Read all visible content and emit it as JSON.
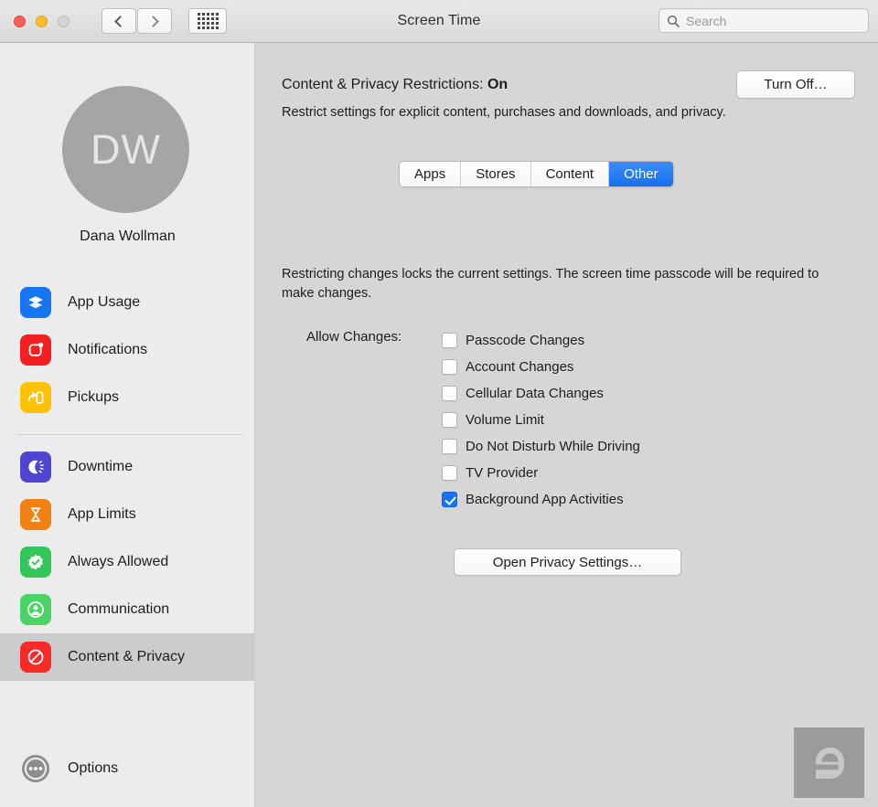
{
  "window": {
    "title": "Screen Time",
    "traffic_lights": [
      "close",
      "minimize",
      "zoom"
    ],
    "back_label": "Back",
    "forward_label": "Forward",
    "grid_label": "Show All"
  },
  "search": {
    "placeholder": "Search",
    "value": "",
    "icon": "search-icon"
  },
  "sidebar": {
    "avatar_initials": "DW",
    "user_name": "Dana Wollman",
    "groups": [
      {
        "items": [
          {
            "label": "App Usage",
            "icon": "layers-icon",
            "color": "#1675f2",
            "selected": false
          },
          {
            "label": "Notifications",
            "icon": "notification-icon",
            "color": "#f4201f",
            "selected": false
          },
          {
            "label": "Pickups",
            "icon": "pickup-arrow-icon",
            "color": "#ffc200",
            "selected": false
          }
        ]
      },
      {
        "items": [
          {
            "label": "Downtime",
            "icon": "moon-sun-icon",
            "color": "#4f46cf",
            "selected": false
          },
          {
            "label": "App Limits",
            "icon": "hourglass-icon",
            "color": "#f08215",
            "selected": false
          },
          {
            "label": "Always Allowed",
            "icon": "checkbadge-icon",
            "color": "#33c759",
            "selected": false
          },
          {
            "label": "Communication",
            "icon": "person-icon",
            "color": "#4cd365",
            "selected": false
          },
          {
            "label": "Content & Privacy",
            "icon": "prohibit-icon",
            "color": "#fa2a27",
            "selected": true
          }
        ]
      },
      {
        "items": [
          {
            "label": "Options",
            "icon": "ellipsis-icon",
            "color": "#8c8c8c",
            "selected": false
          }
        ]
      }
    ]
  },
  "main": {
    "header_title_prefix": "Content & Privacy Restrictions: ",
    "header_title_state": "On",
    "header_subtitle": "Restrict settings for explicit content, purchases and downloads, and privacy.",
    "turn_off_button": "Turn Off…",
    "tabs": [
      {
        "label": "Apps",
        "active": false
      },
      {
        "label": "Stores",
        "active": false
      },
      {
        "label": "Content",
        "active": false
      },
      {
        "label": "Other",
        "active": true
      }
    ],
    "restrict_note": "Restricting changes locks the current settings. The screen time passcode will be required to make changes.",
    "allow_changes_label": "Allow Changes:",
    "checkboxes": [
      {
        "label": "Passcode Changes",
        "checked": false
      },
      {
        "label": "Account Changes",
        "checked": false
      },
      {
        "label": "Cellular Data Changes",
        "checked": false
      },
      {
        "label": "Volume Limit",
        "checked": false
      },
      {
        "label": "Do Not Disturb While Driving",
        "checked": false
      },
      {
        "label": "TV Provider",
        "checked": false
      },
      {
        "label": "Background App Activities",
        "checked": true
      }
    ],
    "privacy_button": "Open Privacy Settings…",
    "watermark_letter": "e"
  },
  "colors": {
    "accent_blue": "#1574f0",
    "sidebar_bg": "#ececec",
    "content_bg": "#d6d6d6",
    "selected_row": "#cccccc"
  }
}
